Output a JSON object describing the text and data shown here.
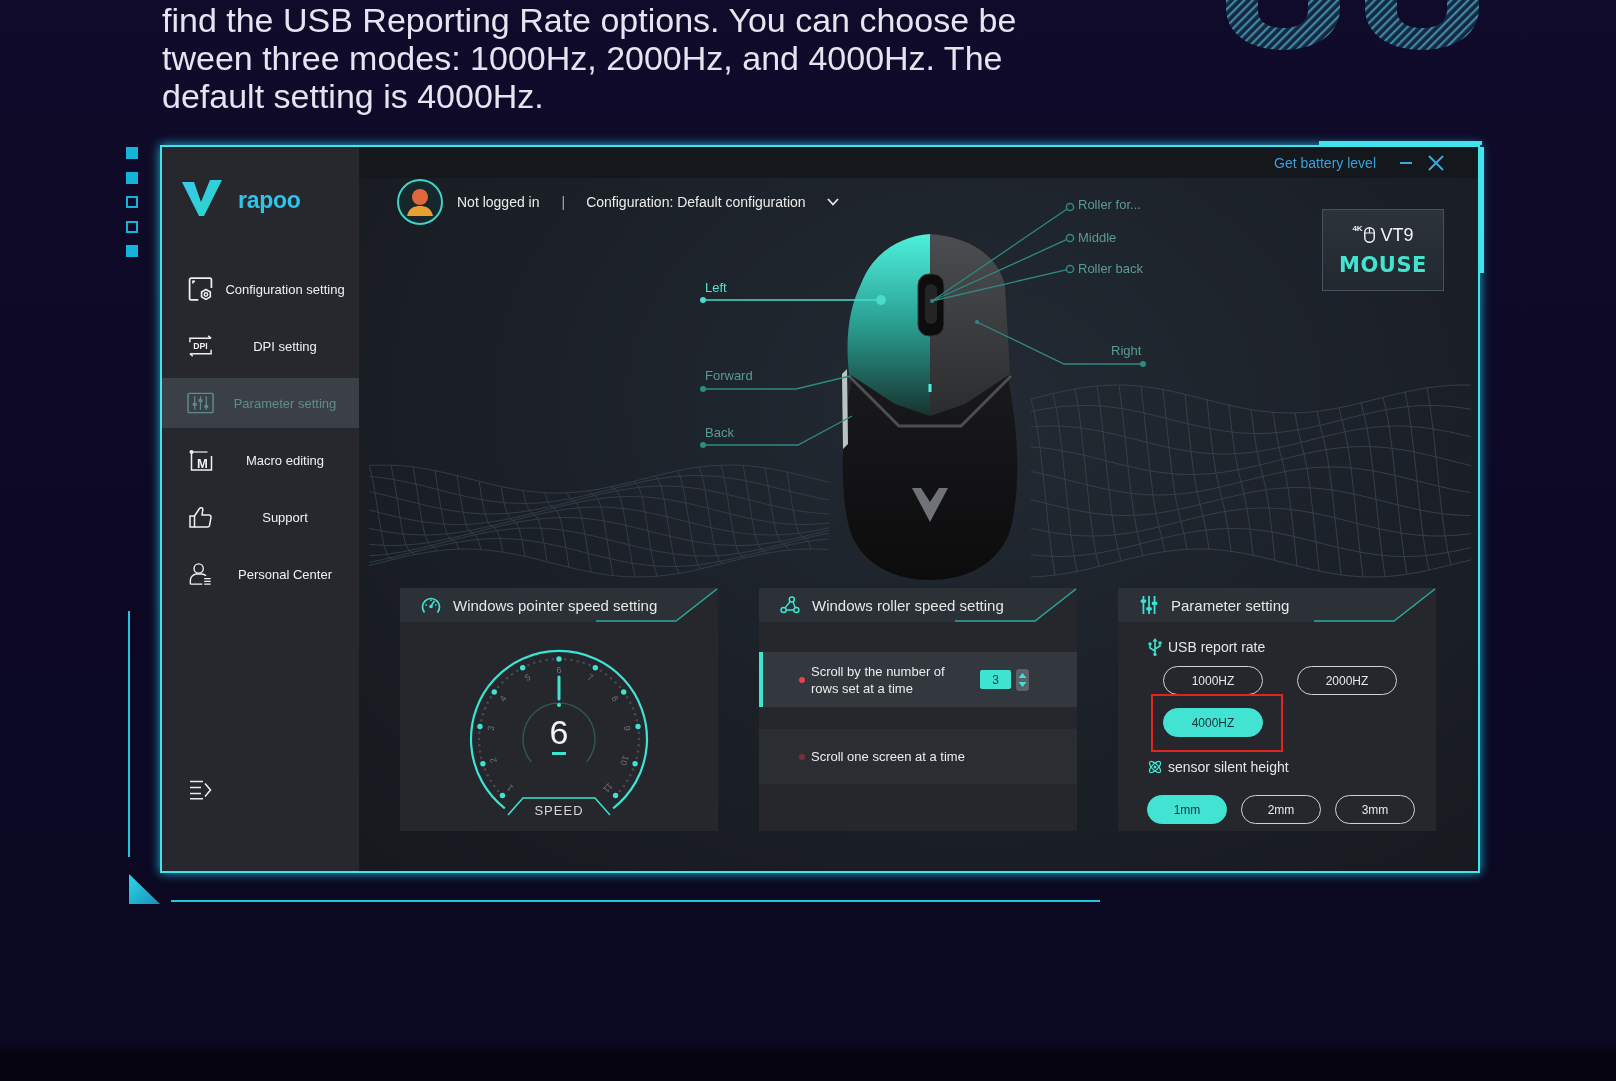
{
  "description": {
    "lines": [
      "find the USB Reporting Rate options. You can choose be",
      "tween three modes: 1000Hz, 2000Hz, and 4000Hz. The",
      "default setting is 4000Hz."
    ]
  },
  "side_markers": [
    {
      "filled": true
    },
    {
      "filled": true
    },
    {
      "filled": false
    },
    {
      "filled": false
    },
    {
      "filled": true
    }
  ],
  "sidebar": {
    "logo": "rapoo",
    "items": [
      {
        "label": "Configuration setting",
        "selected": false
      },
      {
        "label": "DPI setting",
        "icon_text": "DPI",
        "selected": false
      },
      {
        "label": "Parameter setting",
        "selected": true
      },
      {
        "label": "Macro editing",
        "icon_text": "M",
        "selected": false
      },
      {
        "label": "Support",
        "selected": false
      },
      {
        "label": "Personal Center",
        "selected": false
      }
    ]
  },
  "title_bar": {
    "battery_link": "Get battery level"
  },
  "header": {
    "login_status": "Not logged in",
    "separator": "|",
    "configuration": "Configuration: Default configuration"
  },
  "device_badge": {
    "tag": "4K",
    "model": "VT9",
    "type": "MOUSE"
  },
  "mouse_buttons": [
    {
      "label": "Left",
      "selected": true
    },
    {
      "label": "Forward",
      "selected": false
    },
    {
      "label": "Back",
      "selected": false
    },
    {
      "label": "Roller for...",
      "selected": false
    },
    {
      "label": "Middle",
      "selected": false
    },
    {
      "label": "Roller back",
      "selected": false
    },
    {
      "label": "Right",
      "selected": false
    }
  ],
  "pointer_speed": {
    "title": "Windows pointer speed setting",
    "ticks": [
      "1",
      "2",
      "3",
      "4",
      "5",
      "6",
      "7",
      "8",
      "9",
      "10",
      "11"
    ],
    "level": 0.5,
    "value": "6",
    "caption": "SPEED"
  },
  "roller_speed": {
    "title": "Windows roller speed setting",
    "options": [
      {
        "kind": "spin",
        "label": "Scroll by the number of rows set at a time",
        "value": "3",
        "selected": true
      },
      {
        "kind": "plain",
        "label": "Scroll one screen at a time",
        "selected": false
      }
    ]
  },
  "parameters": {
    "title": "Parameter setting",
    "groups": [
      {
        "kind": "usb",
        "label": "USB report rate",
        "options": [
          {
            "label": "1000HZ",
            "selected": false,
            "highlighted": false
          },
          {
            "label": "2000HZ",
            "selected": false,
            "highlighted": false
          },
          {
            "label": "4000HZ",
            "selected": true,
            "highlighted": true
          }
        ]
      },
      {
        "kind": "sensor",
        "label": "sensor silent height",
        "options": [
          {
            "label": "1mm",
            "selected": true
          },
          {
            "label": "2mm",
            "selected": false
          },
          {
            "label": "3mm",
            "selected": false
          }
        ]
      }
    ]
  }
}
